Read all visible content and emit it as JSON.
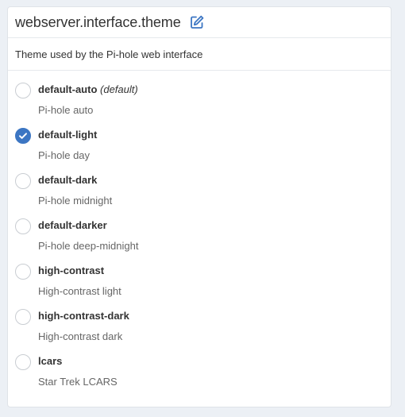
{
  "setting": {
    "title": "webserver.interface.theme",
    "description": "Theme used by the Pi-hole web interface"
  },
  "colors": {
    "accent": "#3c76c3",
    "background": "#ecf0f5"
  },
  "options": [
    {
      "name": "default-auto",
      "default_note": "(default)",
      "subtitle": "Pi-hole auto",
      "checked": false
    },
    {
      "name": "default-light",
      "default_note": "",
      "subtitle": "Pi-hole day",
      "checked": true
    },
    {
      "name": "default-dark",
      "default_note": "",
      "subtitle": "Pi-hole midnight",
      "checked": false
    },
    {
      "name": "default-darker",
      "default_note": "",
      "subtitle": "Pi-hole deep-midnight",
      "checked": false
    },
    {
      "name": "high-contrast",
      "default_note": "",
      "subtitle": "High-contrast light",
      "checked": false
    },
    {
      "name": "high-contrast-dark",
      "default_note": "",
      "subtitle": "High-contrast dark",
      "checked": false
    },
    {
      "name": "lcars",
      "default_note": "",
      "subtitle": "Star Trek LCARS",
      "checked": false
    }
  ]
}
